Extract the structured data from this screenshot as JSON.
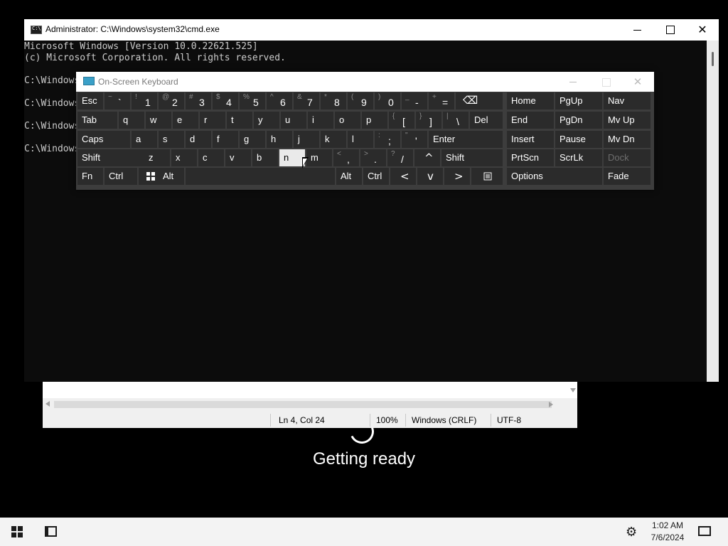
{
  "background": {
    "status_text": "Getting ready"
  },
  "notepad": {
    "status_bar": {
      "position": "Ln 4, Col 24",
      "zoom": "100%",
      "line_ending": "Windows (CRLF)",
      "encoding": "UTF-8"
    }
  },
  "cmd": {
    "title": "Administrator: C:\\Windows\\system32\\cmd.exe",
    "lines": [
      "Microsoft Windows [Version 10.0.22621.525]",
      "(c) Microsoft Corporation. All rights reserved.",
      "",
      "C:\\Windows",
      "",
      "C:\\Windows",
      "",
      "C:\\Windows",
      "",
      "C:\\Windows"
    ],
    "close_label": "✕"
  },
  "osk": {
    "title": "On-Screen Keyboard",
    "close_label": "✕",
    "rows": [
      [
        {
          "label": "Esc"
        },
        {
          "shift": "~",
          "main": "`"
        },
        {
          "shift": "!",
          "main": "1"
        },
        {
          "shift": "@",
          "main": "2"
        },
        {
          "shift": "#",
          "main": "3"
        },
        {
          "shift": "$",
          "main": "4"
        },
        {
          "shift": "%",
          "main": "5"
        },
        {
          "shift": "^",
          "main": "6"
        },
        {
          "shift": "&",
          "main": "7"
        },
        {
          "shift": "*",
          "main": "8"
        },
        {
          "shift": "(",
          "main": "9"
        },
        {
          "shift": ")",
          "main": "0"
        },
        {
          "shift": "_",
          "main": "-"
        },
        {
          "shift": "+",
          "main": "="
        },
        {
          "label": "⌫"
        }
      ],
      [
        {
          "label": "Tab"
        },
        {
          "label": "q"
        },
        {
          "label": "w"
        },
        {
          "label": "e"
        },
        {
          "label": "r"
        },
        {
          "label": "t"
        },
        {
          "label": "y"
        },
        {
          "label": "u"
        },
        {
          "label": "i"
        },
        {
          "label": "o"
        },
        {
          "label": "p"
        },
        {
          "shift": "{",
          "main": "["
        },
        {
          "shift": "}",
          "main": "]"
        },
        {
          "shift": "|",
          "main": "\\"
        },
        {
          "label": "Del"
        }
      ],
      [
        {
          "label": "Caps"
        },
        {
          "label": "a"
        },
        {
          "label": "s"
        },
        {
          "label": "d"
        },
        {
          "label": "f"
        },
        {
          "label": "g"
        },
        {
          "label": "h"
        },
        {
          "label": "j"
        },
        {
          "label": "k"
        },
        {
          "label": "l"
        },
        {
          "shift": ":",
          "main": ";"
        },
        {
          "shift": "\"",
          "main": "'"
        },
        {
          "label": "Enter"
        }
      ],
      [
        {
          "label": "Shift"
        },
        {
          "label": "z"
        },
        {
          "label": "x"
        },
        {
          "label": "c"
        },
        {
          "label": "v"
        },
        {
          "label": "b"
        },
        {
          "label": "n"
        },
        {
          "label": "m"
        },
        {
          "shift": "<",
          "main": ","
        },
        {
          "shift": ">",
          "main": "."
        },
        {
          "shift": "?",
          "main": "/"
        },
        {
          "label": "^"
        },
        {
          "label": "Shift"
        }
      ],
      [
        {
          "label": "Fn"
        },
        {
          "label": "Ctrl"
        },
        {
          "label": "windows-icon"
        },
        {
          "label": "Alt"
        },
        {
          "label": ""
        },
        {
          "label": "Alt"
        },
        {
          "label": "Ctrl"
        },
        {
          "label": "<"
        },
        {
          "label": "v"
        },
        {
          "label": ">"
        },
        {
          "label": "menu-icon"
        }
      ]
    ],
    "nav_keys": [
      [
        "Home",
        "PgUp",
        "Nav"
      ],
      [
        "End",
        "PgDn",
        "Mv Up"
      ],
      [
        "Insert",
        "Pause",
        "Mv Dn"
      ],
      [
        "PrtScn",
        "ScrLk",
        "Dock"
      ],
      [
        "Options",
        "",
        "Fade"
      ]
    ],
    "pressed_key": "n"
  },
  "taskbar": {
    "time": "1:02 AM",
    "date": "7/6/2024"
  }
}
